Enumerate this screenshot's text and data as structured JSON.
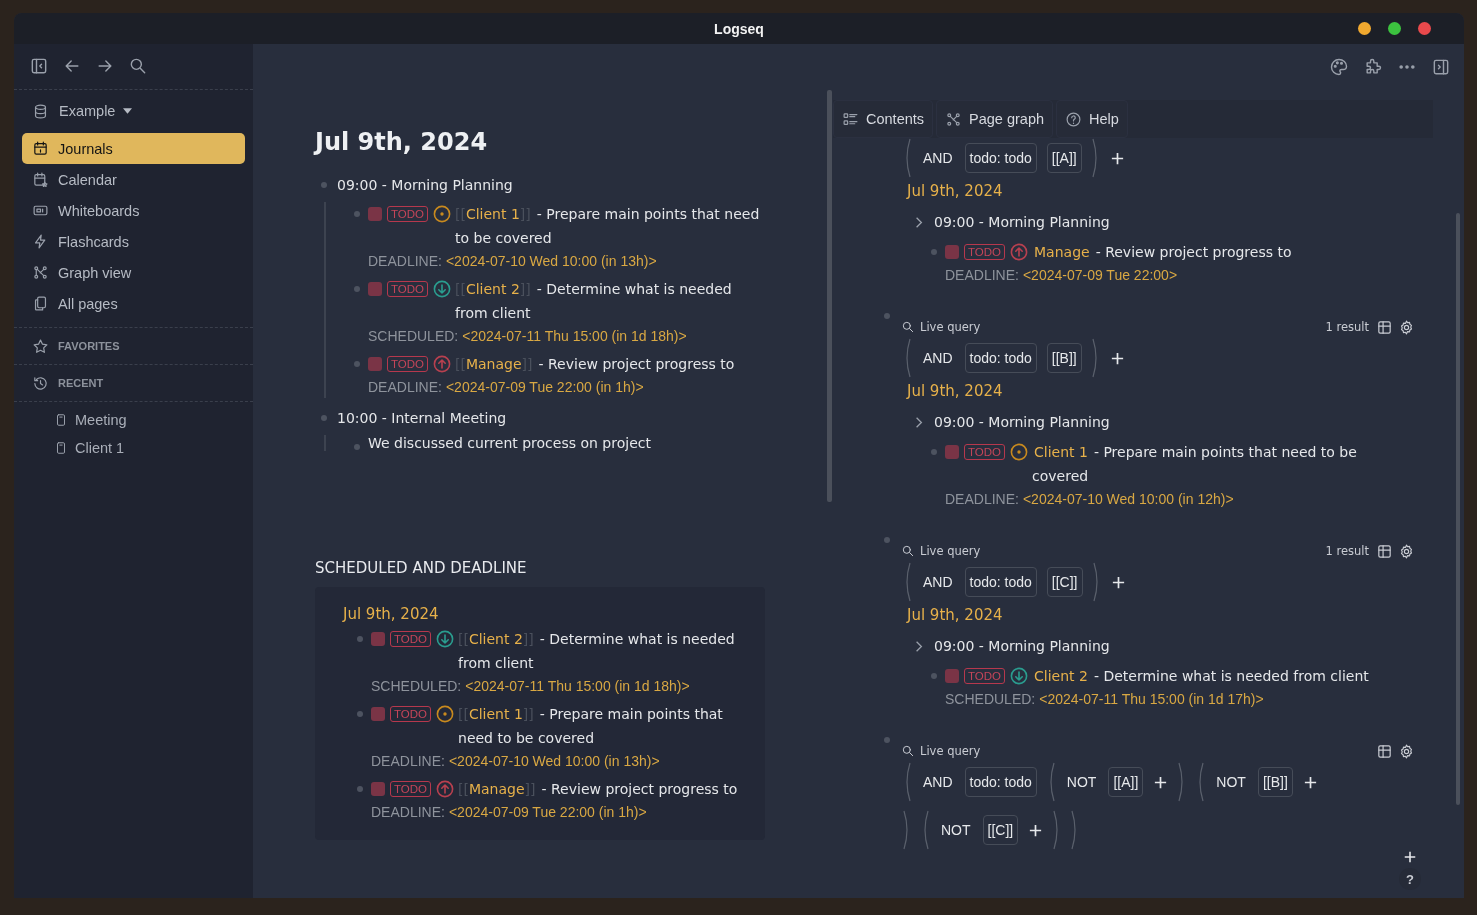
{
  "window": {
    "title": "Logseq"
  },
  "sidebar": {
    "graph": "Example",
    "nav": [
      {
        "label": "Journals",
        "selected": true
      },
      {
        "label": "Calendar",
        "selected": false
      },
      {
        "label": "Whiteboards",
        "selected": false
      },
      {
        "label": "Flashcards",
        "selected": false
      },
      {
        "label": "Graph view",
        "selected": false
      },
      {
        "label": "All pages",
        "selected": false
      }
    ],
    "favorites": "FAVORITES",
    "recent": "RECENT",
    "recent_items": [
      "Meeting",
      "Client 1"
    ]
  },
  "journal": {
    "title": "Jul 9th, 2024",
    "blocks": [
      {
        "text": "09:00 - Morning Planning",
        "children": [
          {
            "kind": "task",
            "checked": false,
            "marker": "TODO",
            "color": "#c98a1e",
            "open": "[[",
            "page": "Client 1",
            "close": "]]",
            "text": "- Prepare main points that need to be covered",
            "date_label": "DEADLINE:",
            "date": "<2024-07-10 Wed 10:00 (in 13h)>"
          },
          {
            "kind": "task",
            "checked": false,
            "marker": "TODO",
            "color": "#2a9d8f",
            "open": "[[",
            "page": "Client 2",
            "close": "]]",
            "text": "- Determine what is needed from client",
            "date_label": "SCHEDULED:",
            "date": "<2024-07-11 Thu 15:00 (in 1d 18h)>"
          },
          {
            "kind": "task",
            "checked": false,
            "marker": "TODO",
            "color": "#b8404f",
            "open": "[[",
            "page": "Manage",
            "close": "]]",
            "text": "- Review project progress to",
            "date_label": "DEADLINE:",
            "date": "<2024-07-09 Tue 22:00 (in 1h)>"
          }
        ]
      },
      {
        "text": "10:00 - Internal Meeting",
        "children": [
          {
            "kind": "text",
            "text": "We discussed current process on project"
          }
        ]
      }
    ]
  },
  "scheduled": {
    "heading": "SCHEDULED AND DEADLINE",
    "date": "Jul 9th, 2024",
    "tasks": [
      {
        "checked": false,
        "marker": "TODO",
        "color": "#2a9d8f",
        "open": "[[",
        "page": "Client 2",
        "close": "]]",
        "text": "- Determine what is needed from client",
        "date_label": "SCHEDULED:",
        "date": "<2024-07-11 Thu 15:00 (in 1d 18h)>"
      },
      {
        "checked": false,
        "marker": "TODO",
        "color": "#c98a1e",
        "open": "[[",
        "page": "Client 1",
        "close": "]]",
        "text": "- Prepare main points that need to be covered",
        "date_label": "DEADLINE:",
        "date": "<2024-07-10 Wed 10:00 (in 13h)>"
      },
      {
        "checked": false,
        "marker": "TODO",
        "color": "#b8404f",
        "open": "[[",
        "page": "Manage",
        "close": "]]",
        "text": "- Review project progress to",
        "date_label": "DEADLINE:",
        "date": "<2024-07-09 Tue 22:00 (in 1h)>"
      }
    ]
  },
  "right_panel": {
    "tabs": [
      "Contents",
      "Page graph",
      "Help"
    ],
    "help_button": "?",
    "queries": [
      {
        "filters": [
          {
            "kind": "group",
            "items": [
              {
                "kind": "op",
                "text": "AND"
              },
              {
                "kind": "chip",
                "text": "todo: todo"
              },
              {
                "kind": "chip",
                "text": "[[A]]"
              }
            ]
          },
          {
            "kind": "add"
          }
        ],
        "results": {
          "date": "Jul 9th, 2024",
          "parent": "09:00 - Morning Planning",
          "tasks": [
            {
              "checked": false,
              "marker": "TODO",
              "color": "#b8404f",
              "page": "Manage",
              "text": "- Review project progress to",
              "date_label": "DEADLINE:",
              "date": "<2024-07-09 Tue 22:00>"
            }
          ]
        }
      },
      {
        "label": "Live query",
        "count": "1 result",
        "filters": [
          {
            "kind": "group",
            "items": [
              {
                "kind": "op",
                "text": "AND"
              },
              {
                "kind": "chip",
                "text": "todo: todo"
              },
              {
                "kind": "chip",
                "text": "[[B]]"
              }
            ]
          },
          {
            "kind": "add"
          }
        ],
        "results": {
          "date": "Jul 9th, 2024",
          "parent": "09:00 - Morning Planning",
          "tasks": [
            {
              "checked": false,
              "marker": "TODO",
              "color": "#c98a1e",
              "page": "Client 1",
              "text": "- Prepare main points that need to be covered",
              "date_label": "DEADLINE:",
              "date": "<2024-07-10 Wed 10:00 (in 12h)>"
            }
          ]
        }
      },
      {
        "label": "Live query",
        "count": "1 result",
        "filters": [
          {
            "kind": "group",
            "items": [
              {
                "kind": "op",
                "text": "AND"
              },
              {
                "kind": "chip",
                "text": "todo: todo"
              },
              {
                "kind": "chip",
                "text": "[[C]]"
              }
            ]
          },
          {
            "kind": "add"
          }
        ],
        "results": {
          "date": "Jul 9th, 2024",
          "parent": "09:00 - Morning Planning",
          "tasks": [
            {
              "checked": false,
              "marker": "TODO",
              "color": "#2a9d8f",
              "page": "Client 2",
              "text": "- Determine what is needed from client",
              "date_label": "SCHEDULED:",
              "date": "<2024-07-11 Thu 15:00 (in 1d 17h)>"
            }
          ]
        }
      },
      {
        "label": "Live query",
        "filters": [
          {
            "kind": "group",
            "items": [
              {
                "kind": "op",
                "text": "AND"
              },
              {
                "kind": "chip",
                "text": "todo: todo"
              },
              {
                "kind": "group",
                "items": [
                  {
                    "kind": "op",
                    "text": "NOT"
                  },
                  {
                    "kind": "chip",
                    "text": "[[A]]"
                  },
                  {
                    "kind": "add"
                  }
                ]
              },
              {
                "kind": "group",
                "items": [
                  {
                    "kind": "op",
                    "text": "NOT"
                  },
                  {
                    "kind": "chip",
                    "text": "[[B]]"
                  },
                  {
                    "kind": "add"
                  }
                ]
              },
              {
                "kind": "group",
                "items": [
                  {
                    "kind": "op",
                    "text": "NOT"
                  },
                  {
                    "kind": "chip",
                    "text": "[[C]]"
                  },
                  {
                    "kind": "add"
                  }
                ]
              }
            ]
          }
        ]
      }
    ]
  }
}
